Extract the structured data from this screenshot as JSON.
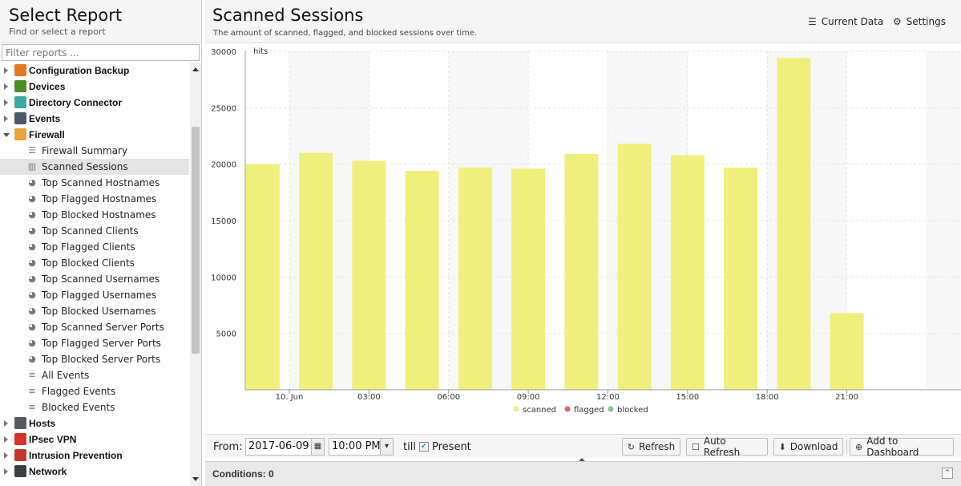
{
  "left": {
    "title": "Select Report",
    "subtitle": "Find or select a report",
    "filter_placeholder": "Filter reports ...",
    "tree": [
      {
        "kind": "cat",
        "label": "Configuration Backup",
        "icon": "config-backup-icon",
        "color": "#e07b1f",
        "expanded": false
      },
      {
        "kind": "cat",
        "label": "Devices",
        "icon": "devices-icon",
        "color": "#4a8c2a",
        "expanded": false
      },
      {
        "kind": "cat",
        "label": "Directory Connector",
        "icon": "directory-connector-icon",
        "color": "#3aa9a2",
        "expanded": false
      },
      {
        "kind": "cat",
        "label": "Events",
        "icon": "events-icon",
        "color": "#4b5a6a",
        "expanded": false
      },
      {
        "kind": "cat",
        "label": "Firewall",
        "icon": "firewall-icon",
        "color": "#e9a33a",
        "expanded": true
      },
      {
        "kind": "sub",
        "label": "Firewall Summary",
        "icon": "summary-list-icon"
      },
      {
        "kind": "sub",
        "label": "Scanned Sessions",
        "icon": "bar-chart-icon",
        "selected": true
      },
      {
        "kind": "sub",
        "label": "Top Scanned Hostnames",
        "icon": "pie-chart-icon"
      },
      {
        "kind": "sub",
        "label": "Top Flagged Hostnames",
        "icon": "pie-chart-icon"
      },
      {
        "kind": "sub",
        "label": "Top Blocked Hostnames",
        "icon": "pie-chart-icon"
      },
      {
        "kind": "sub",
        "label": "Top Scanned Clients",
        "icon": "pie-chart-icon"
      },
      {
        "kind": "sub",
        "label": "Top Flagged Clients",
        "icon": "pie-chart-icon"
      },
      {
        "kind": "sub",
        "label": "Top Blocked Clients",
        "icon": "pie-chart-icon"
      },
      {
        "kind": "sub",
        "label": "Top Scanned Usernames",
        "icon": "pie-chart-icon"
      },
      {
        "kind": "sub",
        "label": "Top Flagged Usernames",
        "icon": "pie-chart-icon"
      },
      {
        "kind": "sub",
        "label": "Top Blocked Usernames",
        "icon": "pie-chart-icon"
      },
      {
        "kind": "sub",
        "label": "Top Scanned Server Ports",
        "icon": "pie-chart-icon"
      },
      {
        "kind": "sub",
        "label": "Top Flagged Server Ports",
        "icon": "pie-chart-icon"
      },
      {
        "kind": "sub",
        "label": "Top Blocked Server Ports",
        "icon": "pie-chart-icon"
      },
      {
        "kind": "sub",
        "label": "All Events",
        "icon": "event-list-icon"
      },
      {
        "kind": "sub",
        "label": "Flagged Events",
        "icon": "event-list-icon"
      },
      {
        "kind": "sub",
        "label": "Blocked Events",
        "icon": "event-list-icon"
      },
      {
        "kind": "cat",
        "label": "Hosts",
        "icon": "hosts-icon",
        "color": "#555a60",
        "expanded": false
      },
      {
        "kind": "cat",
        "label": "IPsec VPN",
        "icon": "ipsec-vpn-icon",
        "color": "#d7322b",
        "expanded": false
      },
      {
        "kind": "cat",
        "label": "Intrusion Prevention",
        "icon": "intrusion-prevention-icon",
        "color": "#c0392b",
        "expanded": false
      },
      {
        "kind": "cat",
        "label": "Network",
        "icon": "network-icon",
        "color": "#3a3f44",
        "expanded": false
      }
    ]
  },
  "main": {
    "title": "Scanned Sessions",
    "subtitle": "The amount of scanned, flagged, and blocked sessions over time.",
    "current_data_label": "Current Data",
    "settings_label": "Settings"
  },
  "chart_data": {
    "type": "bar",
    "ylabel": "hits",
    "ylim": [
      0,
      30000
    ],
    "yticks": [
      5000,
      10000,
      15000,
      20000,
      25000,
      30000
    ],
    "xticks": [
      "10. Jun",
      "03:00",
      "06:00",
      "09:00",
      "12:00",
      "15:00",
      "18:00",
      "21:00"
    ],
    "categories": [
      "2017-06-09 22:00",
      "2017-06-10 00:00",
      "2017-06-10 02:00",
      "2017-06-10 04:00",
      "2017-06-10 06:00",
      "2017-06-10 08:00",
      "2017-06-10 10:00",
      "2017-06-10 12:00",
      "2017-06-10 14:00",
      "2017-06-10 16:00",
      "2017-06-10 18:00",
      "2017-06-10 20:00",
      "2017-06-10 22:00"
    ],
    "series": [
      {
        "name": "scanned",
        "color": "#f0ef7c",
        "values": [
          20000,
          21000,
          20300,
          19400,
          19700,
          19600,
          20900,
          21800,
          20800,
          19700,
          29400,
          6800
        ]
      },
      {
        "name": "flagged",
        "color": "#c96a6a",
        "values": []
      },
      {
        "name": "blocked",
        "color": "#8fbf8f",
        "values": []
      }
    ],
    "grid": true,
    "legend": "bottom-center"
  },
  "toolbar": {
    "from_label": "From:",
    "from_date": "2017-06-09",
    "from_time": "10:00 PM",
    "till_label": "till",
    "present_label": "Present",
    "present_checked": true,
    "refresh_label": "Refresh",
    "auto_refresh_label": "Auto Refresh",
    "download_label": "Download",
    "add_dashboard_label": "Add to Dashboard"
  },
  "conditions": {
    "label": "Conditions: 0"
  }
}
